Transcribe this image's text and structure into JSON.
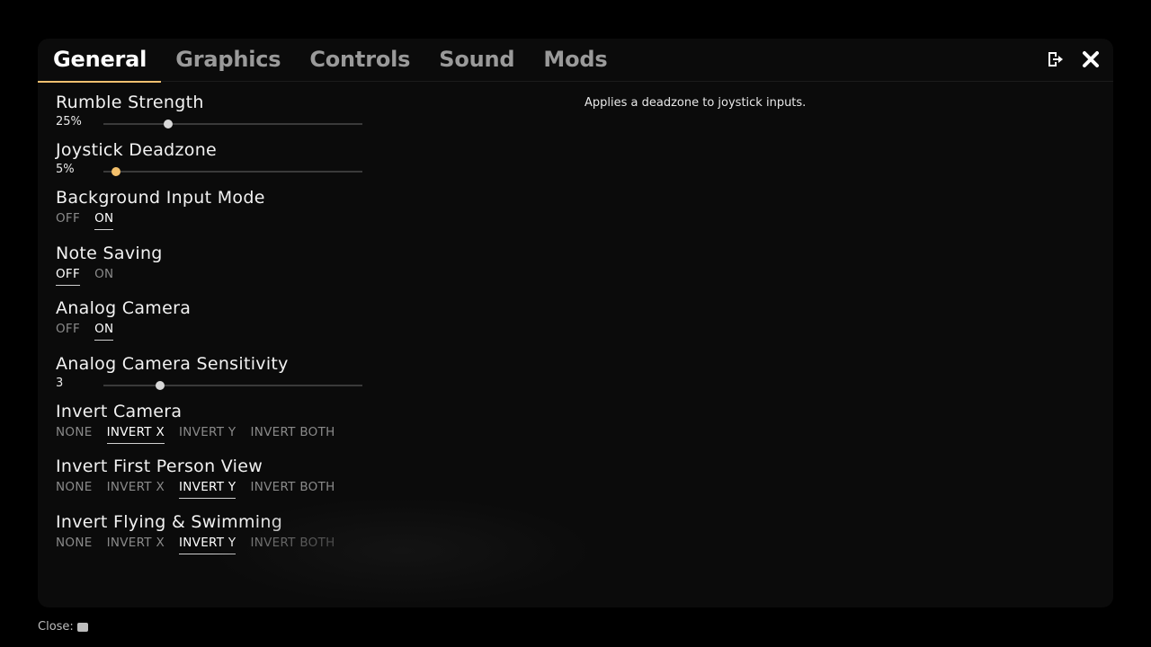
{
  "tabs": [
    {
      "label": "General",
      "active": true
    },
    {
      "label": "Graphics",
      "active": false
    },
    {
      "label": "Controls",
      "active": false
    },
    {
      "label": "Sound",
      "active": false
    },
    {
      "label": "Mods",
      "active": false
    }
  ],
  "icons": {
    "exit": "exit-icon",
    "close": "close-icon",
    "esc": "esc-key-icon"
  },
  "settings": {
    "rumble": {
      "label": "Rumble Strength",
      "value_text": "25%",
      "fraction": 0.25
    },
    "deadzone": {
      "label": "Joystick Deadzone",
      "value_text": "5%",
      "fraction": 0.05
    },
    "background_input": {
      "label": "Background Input Mode",
      "options": [
        "OFF",
        "ON"
      ],
      "selected": 1
    },
    "note_saving": {
      "label": "Note Saving",
      "options": [
        "OFF",
        "ON"
      ],
      "selected": 0
    },
    "analog_camera": {
      "label": "Analog Camera",
      "options": [
        "OFF",
        "ON"
      ],
      "selected": 1
    },
    "analog_sensitivity": {
      "label": "Analog Camera Sensitivity",
      "value_text": "3",
      "fraction": 0.22
    },
    "invert_camera": {
      "label": "Invert Camera",
      "options": [
        "NONE",
        "INVERT X",
        "INVERT Y",
        "INVERT BOTH"
      ],
      "selected": 1
    },
    "invert_fpv": {
      "label": "Invert First Person View",
      "options": [
        "NONE",
        "INVERT X",
        "INVERT Y",
        "INVERT BOTH"
      ],
      "selected": 2
    },
    "invert_flying": {
      "label": "Invert Flying & Swimming",
      "options": [
        "NONE",
        "INVERT X",
        "INVERT Y",
        "INVERT BOTH"
      ],
      "selected": 2
    }
  },
  "description": "Applies a deadzone to joystick inputs.",
  "footer": {
    "close_label": "Close:"
  },
  "colors": {
    "accent": "#f0c070",
    "panel": "#0b0b0b"
  }
}
